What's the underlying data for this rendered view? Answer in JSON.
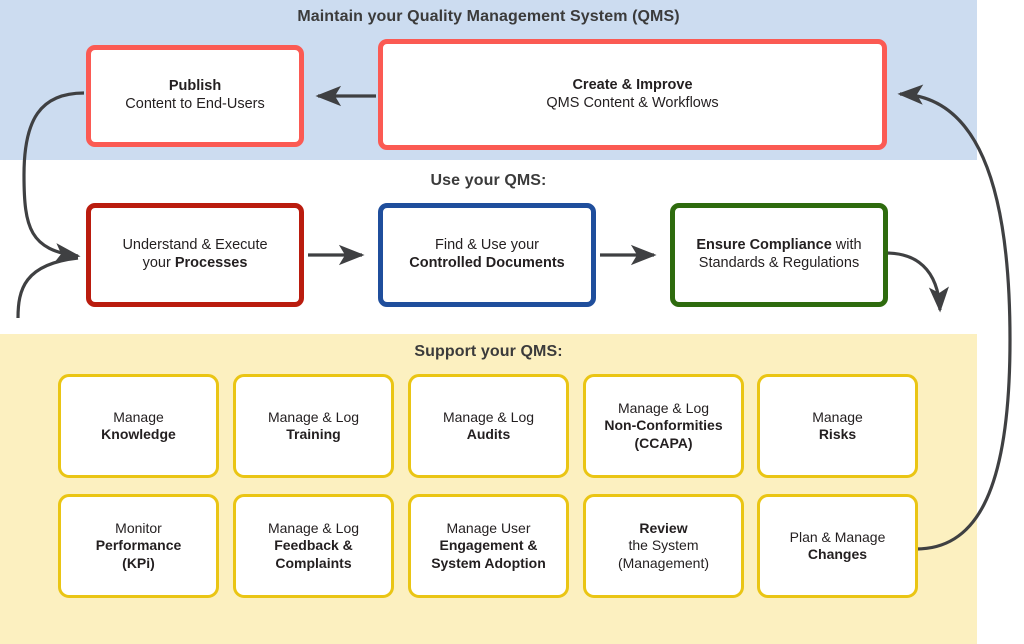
{
  "diagram": {
    "bands": {
      "maintain": {
        "title": "Maintain your Quality Management System (QMS)",
        "color": "#ccdcf0"
      },
      "use": {
        "title": "Use your QMS:",
        "color": "#ffffff"
      },
      "support": {
        "title": "Support your QMS:",
        "color": "#fcf0c0"
      }
    },
    "maintain_nodes": [
      {
        "name": "publish",
        "line1": "Publish",
        "line1_bold": true,
        "line2": "Content to End-Users",
        "line2_bold": false,
        "border_color": "#fb5a53"
      },
      {
        "name": "create-improve",
        "line1": "Create & Improve",
        "line1_bold": true,
        "line2": "QMS Content & Workflows",
        "line2_bold": false,
        "border_color": "#fb5a53"
      }
    ],
    "use_nodes": [
      {
        "name": "understand-execute-processes",
        "line1": "Understand & Execute",
        "line2_prefix": "your ",
        "line2_bold": "Processes",
        "border_color": "#ba1c0e"
      },
      {
        "name": "find-use-controlled-documents",
        "line1": "Find & Use your",
        "line2_prefix": "",
        "line2_bold": "Controlled Documents",
        "border_color": "#1f4e9c"
      },
      {
        "name": "ensure-compliance",
        "line1_bold": "Ensure Compliance",
        "line1_suffix": " with",
        "line2": "Standards & Regulations",
        "border_color": "#2e6b0e"
      }
    ],
    "support_nodes": [
      {
        "name": "manage-knowledge",
        "lines": [
          {
            "text": "Manage",
            "bold": false
          },
          {
            "text": "Knowledge",
            "bold": true
          }
        ]
      },
      {
        "name": "manage-log-training",
        "lines": [
          {
            "text": "Manage & Log",
            "bold": false
          },
          {
            "text": "Training",
            "bold": true
          }
        ]
      },
      {
        "name": "manage-log-audits",
        "lines": [
          {
            "text": "Manage & Log",
            "bold": false
          },
          {
            "text": "Audits",
            "bold": true
          }
        ]
      },
      {
        "name": "manage-log-non-conformities",
        "lines": [
          {
            "text": "Manage & Log",
            "bold": false
          },
          {
            "text": "Non-Conformities",
            "bold": true
          },
          {
            "text": "(CCAPA)",
            "bold": true
          }
        ]
      },
      {
        "name": "manage-risks",
        "lines": [
          {
            "text": "Manage",
            "bold": false
          },
          {
            "text": "Risks",
            "bold": true
          }
        ]
      },
      {
        "name": "monitor-performance-kpi",
        "lines": [
          {
            "text": "Monitor",
            "bold": false
          },
          {
            "text": "Performance",
            "bold": true
          },
          {
            "text": "(KPi)",
            "bold": true
          }
        ]
      },
      {
        "name": "manage-log-feedback-complaints",
        "lines": [
          {
            "text": "Manage & Log",
            "bold": false
          },
          {
            "text": "Feedback &",
            "bold": true
          },
          {
            "text": "Complaints",
            "bold": true
          }
        ]
      },
      {
        "name": "manage-user-engagement-adoption",
        "lines": [
          {
            "text": "Manage User",
            "bold": false
          },
          {
            "text": "Engagement &",
            "bold": true
          },
          {
            "text": "System Adoption",
            "bold": true
          }
        ]
      },
      {
        "name": "review-the-system",
        "lines": [
          {
            "text": "Review",
            "bold": true
          },
          {
            "text": "the System",
            "bold": false
          },
          {
            "text": "(Management)",
            "bold": false
          }
        ]
      },
      {
        "name": "plan-manage-changes",
        "lines": [
          {
            "text": "Plan & Manage",
            "bold": false
          },
          {
            "text": "Changes",
            "bold": true
          }
        ]
      }
    ],
    "connectors": [
      {
        "name": "create-to-publish",
        "kind": "straight-arrow-left"
      },
      {
        "name": "publish-to-processes",
        "kind": "curve-arrow-down-right"
      },
      {
        "name": "support-loop-to-processes",
        "kind": "curve-arrow-up-right"
      },
      {
        "name": "processes-to-documents",
        "kind": "straight-arrow-right"
      },
      {
        "name": "documents-to-compliance",
        "kind": "straight-arrow-right"
      },
      {
        "name": "compliance-to-support",
        "kind": "curve-arrow-down"
      },
      {
        "name": "changes-to-create-improve",
        "kind": "curve-arrow-up-left"
      }
    ],
    "colors": {
      "red_accent": "#fb5a53",
      "dark_red": "#ba1c0e",
      "blue": "#1f4e9c",
      "green": "#2e6b0e",
      "yellow": "#eac514",
      "band_blue": "#ccdcf0",
      "band_yellow": "#fcf0c0",
      "arrow": "#3f4042",
      "text": "#231f20",
      "title_text": "#3b3b3b"
    }
  }
}
